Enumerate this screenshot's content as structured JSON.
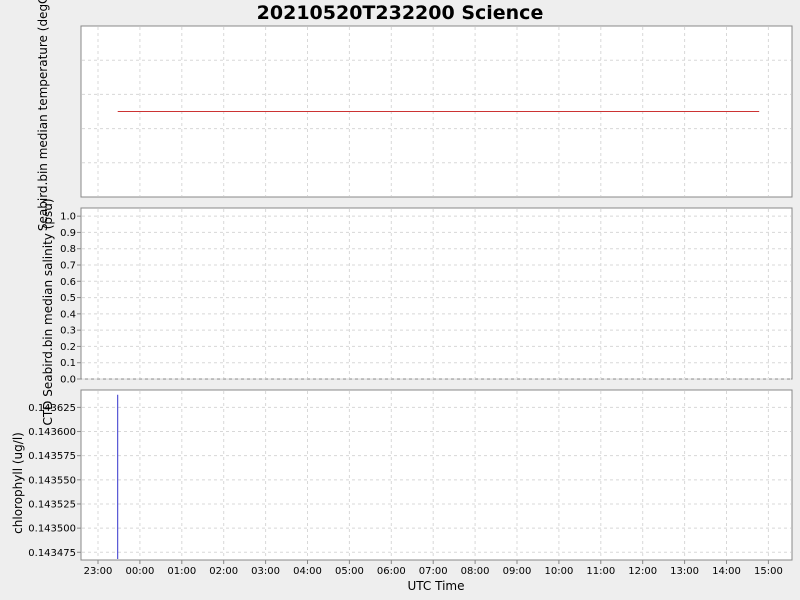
{
  "chart_data": {
    "title": "20210520T232200 Science",
    "type": "line",
    "xlabel": "UTC Time",
    "x_ticks": [
      "23:00",
      "00:00",
      "01:00",
      "02:00",
      "03:00",
      "04:00",
      "05:00",
      "06:00",
      "07:00",
      "08:00",
      "09:00",
      "10:00",
      "11:00",
      "12:00",
      "13:00",
      "14:00",
      "15:00"
    ],
    "panels": [
      {
        "ylabel": "Seabird.bin median temperature (degC)",
        "y_ticks": [],
        "line_color": "#cc3333",
        "series": [
          {
            "x_hours": [
              0.47,
              15.78
            ],
            "y": [
              0.5,
              0.5
            ]
          }
        ],
        "ylim": [
          0,
          1
        ]
      },
      {
        "ylabel": "CTD Seabird.bin median salinity (psu)",
        "y_ticks": [
          "0.0",
          "0.1",
          "0.2",
          "0.3",
          "0.4",
          "0.5",
          "0.6",
          "0.7",
          "0.8",
          "0.9",
          "1.0"
        ],
        "ylim": [
          0,
          1.05
        ],
        "series": []
      },
      {
        "ylabel": "chlorophyll (ug/l)",
        "y_ticks": [
          "0.143475",
          "0.143500",
          "0.143525",
          "0.143550",
          "0.143575",
          "0.143600",
          "0.143625"
        ],
        "ylim": [
          0.143467,
          0.143643
        ],
        "line_color": "#3333cc",
        "series": [
          {
            "x_hours": [
              0.47,
              0.47
            ],
            "y": [
              0.143468,
              0.143638
            ]
          }
        ]
      }
    ]
  }
}
